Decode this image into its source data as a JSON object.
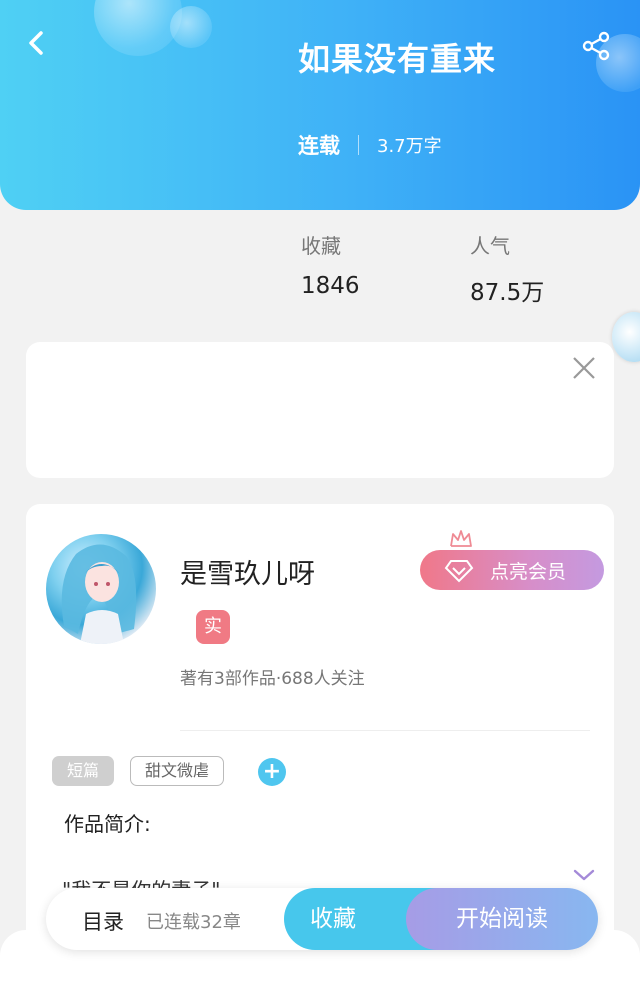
{
  "header": {
    "title": "如果没有重来",
    "status": "连载",
    "word_count": "3.7万字"
  },
  "stats": {
    "favorites_label": "收藏",
    "favorites_value": "1846",
    "popularity_label": "人气",
    "popularity_value": "87.5万"
  },
  "author": {
    "name": "是雪玖儿呀",
    "badge": "实",
    "meta": "著有3部作品·688人关注",
    "vip_button": "点亮会员"
  },
  "tags": {
    "items": [
      "短篇",
      "甜文微虐"
    ],
    "add_label": "+"
  },
  "synopsis": {
    "label": "作品简介:",
    "text": "\"我不是你的妻子\""
  },
  "bottom_bar": {
    "toc_label": "目录",
    "chapter_count": "已连载32章",
    "favorite_button": "收藏",
    "read_button": "开始阅读"
  },
  "colors": {
    "header_gradient_start": "#4fd0f4",
    "header_gradient_end": "#2a93f5",
    "vip_pink": "#f07889",
    "vip_purple": "#c49ae0",
    "accent_cyan": "#47c7ec"
  },
  "icons": [
    "back-icon",
    "share-icon",
    "close-icon",
    "crown-icon",
    "diamond-icon",
    "plus-icon",
    "chevron-down-icon"
  ]
}
